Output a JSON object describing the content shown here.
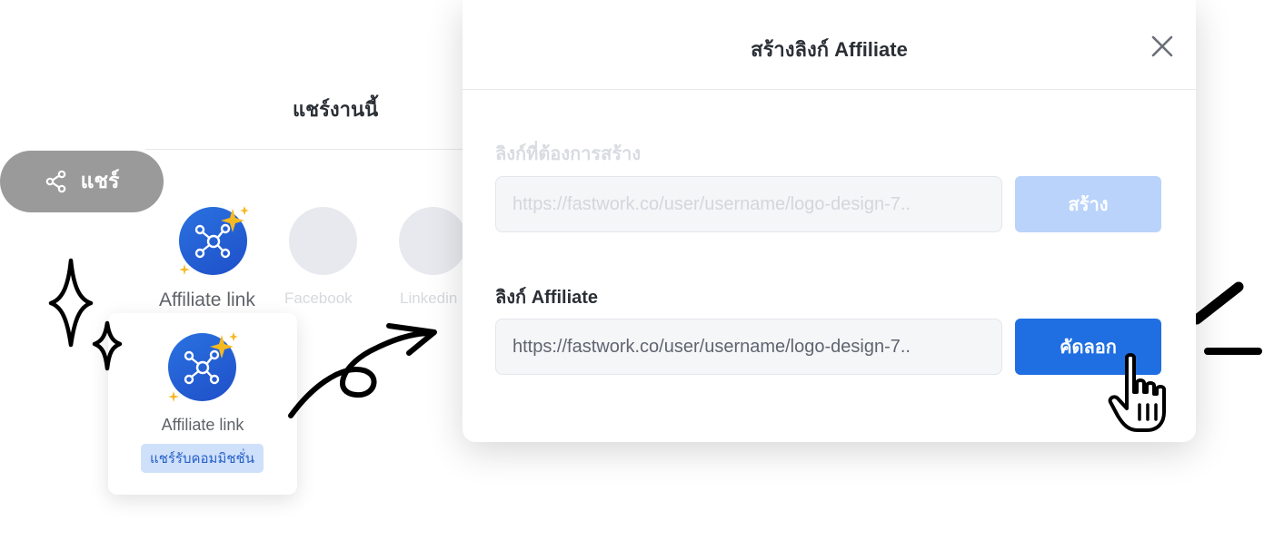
{
  "share_panel": {
    "title": "แชร์งานนี้",
    "share_button_label": "แชร์",
    "options": [
      {
        "label": "Affiliate link",
        "icon": "affiliate-network-icon"
      },
      {
        "label": "Facebook"
      },
      {
        "label": "Linkedin"
      }
    ]
  },
  "affiliate_card": {
    "label": "Affiliate link",
    "badge": "แชร์รับคอมมิชชั่น"
  },
  "modal": {
    "title": "สร้างลิงก์ Affiliate",
    "source_label": "ลิงก์ที่ต้องการสร้าง",
    "source_value": "https://fastwork.co/user/username/logo-design-7..",
    "create_label": "สร้าง",
    "affiliate_label": "ลิงก์ Affiliate",
    "affiliate_value": "https://fastwork.co/user/username/logo-design-7..",
    "copy_label": "คัดลอก"
  },
  "colors": {
    "primary": "#1f6fe3",
    "primary_disabled": "#b9d3fb",
    "badge_bg": "#cfe0fb",
    "pill_bg": "#9a9a9a",
    "sparkle": "#f5b921"
  }
}
